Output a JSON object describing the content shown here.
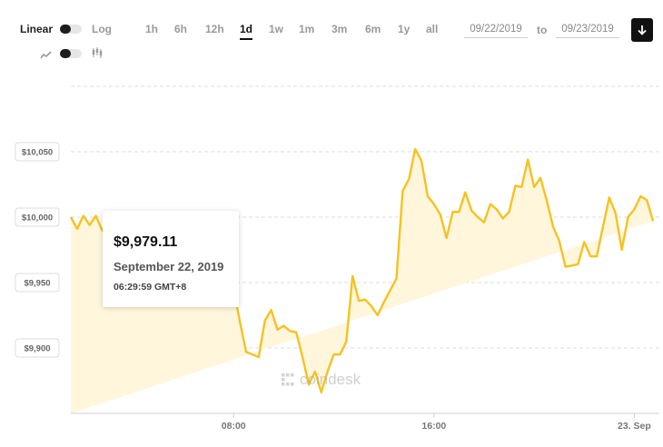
{
  "controls": {
    "scale": {
      "linear": "Linear",
      "log": "Log"
    },
    "ranges": [
      "1h",
      "6h",
      "12h",
      "1d",
      "1w",
      "1m",
      "3m",
      "6m",
      "1y",
      "all"
    ],
    "active_range": "1d",
    "date_from": "09/22/2019",
    "to_label": "to",
    "date_to": "09/23/2019",
    "icons": {
      "line": "line-chart-icon",
      "candle": "candlestick-icon",
      "download": "download-icon",
      "logo": "coindesk-logo"
    }
  },
  "tooltip": {
    "price": "$9,979.11",
    "date": "September 22, 2019",
    "time": "06:29:59 GMT+8"
  },
  "watermark": "coindesk",
  "colors": {
    "line": "#f5c220",
    "fill": "#fff6dc",
    "grid": "#dedede",
    "active": "#111111"
  },
  "chart_data": {
    "type": "area",
    "y_ticks": [
      "$10,050",
      "$10,000",
      "$9,950",
      "$9,900"
    ],
    "y_tick_values": [
      10050,
      10000,
      9950,
      9900
    ],
    "x_ticks": [
      "08:00",
      "16:00",
      "23. Sep"
    ],
    "x_tick_values": [
      8,
      16,
      24
    ],
    "ylim": [
      9850,
      10100
    ],
    "xlim": [
      1.5,
      25
    ],
    "grid": true,
    "x": [
      1.5,
      1.75,
      2.0,
      2.25,
      2.5,
      2.75,
      3.0,
      3.25,
      3.5,
      3.75,
      4.0,
      4.25,
      4.5,
      4.75,
      5.0,
      5.25,
      5.5,
      5.75,
      6.0,
      6.25,
      6.5,
      6.75,
      7.0,
      7.25,
      7.5,
      7.75,
      8.0,
      8.25,
      8.5,
      8.75,
      9.0,
      9.25,
      9.5,
      9.75,
      10.0,
      10.25,
      10.5,
      10.75,
      11.0,
      11.25,
      11.5,
      11.75,
      12.0,
      12.25,
      12.5,
      12.75,
      13.0,
      13.25,
      13.5,
      13.75,
      14.0,
      14.25,
      14.5,
      14.75,
      15.0,
      15.25,
      15.5,
      15.75,
      16.0,
      16.25,
      16.5,
      16.75,
      17.0,
      17.25,
      17.5,
      17.75,
      18.0,
      18.25,
      18.5,
      18.75,
      19.0,
      19.25,
      19.5,
      19.75,
      20.0,
      20.25,
      20.5,
      20.75,
      21.0,
      21.25,
      21.5,
      21.75,
      22.0,
      22.25,
      22.5,
      22.75,
      23.0,
      23.25,
      23.5,
      23.75,
      24.0,
      24.25,
      24.5,
      24.75,
      25.0
    ],
    "values": [
      10000,
      9991,
      10001,
      9994,
      10001,
      9990,
      9985,
      9983,
      9980,
      9978,
      9979,
      9976,
      9975,
      9972,
      9970,
      9969,
      9968,
      9966,
      9964,
      9962,
      9960,
      9958,
      9957,
      9955,
      9953,
      9950,
      9945,
      9920,
      9897,
      9895,
      9893,
      9921,
      9929,
      9914,
      9917,
      9913,
      9912,
      9893,
      9872,
      9882,
      9866,
      9882,
      9895,
      9895,
      9905,
      9955,
      9936,
      9937,
      9932,
      9925,
      9935,
      9944,
      9953,
      10020,
      10029,
      10052,
      10043,
      10016,
      10010,
      10002,
      9984,
      10004,
      10004,
      10019,
      10005,
      10000,
      9996,
      10010,
      10006,
      9999,
      10004,
      10024,
      10023,
      10044,
      10023,
      10030,
      10013,
      9993,
      9982,
      9962,
      9963,
      9964,
      9981,
      9970,
      9970,
      9993,
      10015,
      10003,
      9975,
      10000,
      10006,
      10016,
      10013,
      9997
    ]
  }
}
